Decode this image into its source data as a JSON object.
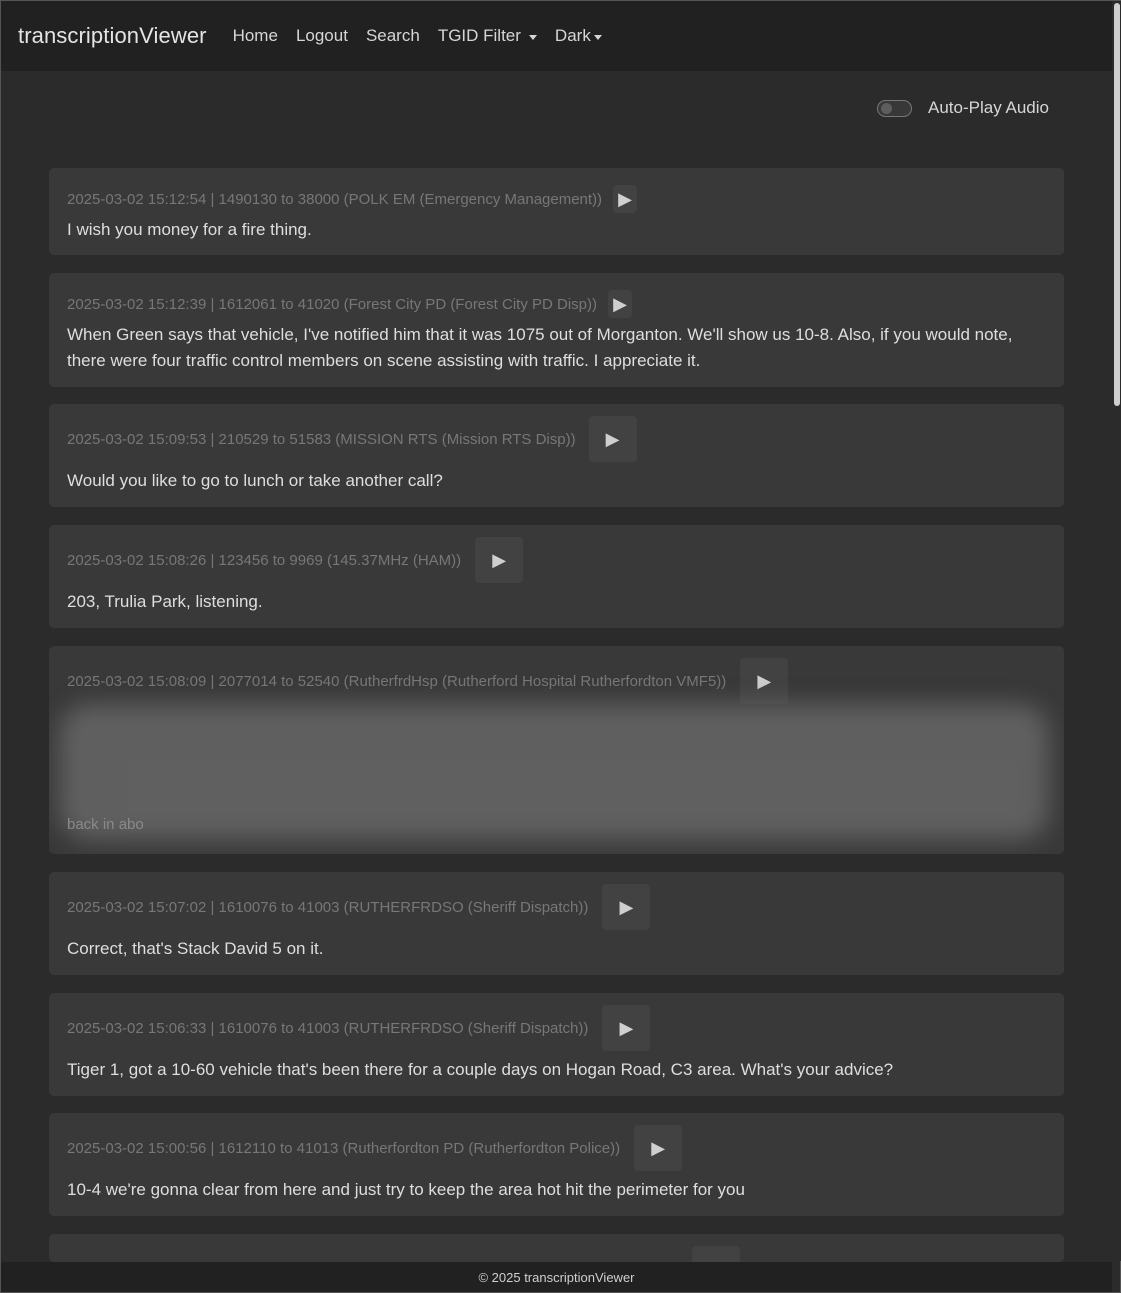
{
  "navbar": {
    "brand": "transcriptionViewer",
    "links": [
      "Home",
      "Logout",
      "Search"
    ],
    "tgid_filter": "TGID Filter",
    "theme": "Dark"
  },
  "autoplay": {
    "label": "Auto-Play Audio",
    "enabled": false
  },
  "play_icon": "▶",
  "entries": [
    {
      "meta": "2025-03-02 15:12:54 | 1490130 to 38000 (POLK EM (Emergency Management))",
      "text": "I wish you money for a fire thing."
    },
    {
      "meta": "2025-03-02 15:12:39 | 1612061 to 41020 (Forest City PD (Forest City PD Disp))",
      "text": "When Green says that vehicle, I've notified him that it was 1075 out of Morganton. We'll show us 10-8. Also, if you would note, there were four traffic control members on scene assisting with traffic. I appreciate it."
    },
    {
      "meta": "2025-03-02 15:09:53 | 210529 to 51583 (MISSION RTS (Mission RTS Disp))",
      "text": "Would you like to go to lunch or take another call?"
    },
    {
      "meta": "2025-03-02 15:08:26 | 123456 to 9969 (145.37MHz (HAM))",
      "text": "203, Trulia Park, listening."
    },
    {
      "meta": "2025-03-02 15:08:09 | 2077014 to 52540 (RutherfrdHsp (Rutherford Hospital Rutherfordton VMF5))",
      "text": "back in abo",
      "redacted": true
    },
    {
      "meta": "2025-03-02 15:07:02 | 1610076 to 41003 (RUTHERFRDSO (Sheriff Dispatch))",
      "text": "Correct, that's Stack David 5 on it."
    },
    {
      "meta": "2025-03-02 15:06:33 | 1610076 to 41003 (RUTHERFRDSO (Sheriff Dispatch))",
      "text": "Tiger 1, got a 10-60 vehicle that's been there for a couple days on Hogan Road, C3 area. What's your advice?"
    },
    {
      "meta": "2025-03-02 15:00:56 | 1612110 to 41013 (Rutherfordton PD (Rutherfordton Police))",
      "text": "10-4 we're gonna clear from here and just try to keep the area hot hit the perimeter for you"
    }
  ],
  "footer": "© 2025 transcriptionViewer"
}
